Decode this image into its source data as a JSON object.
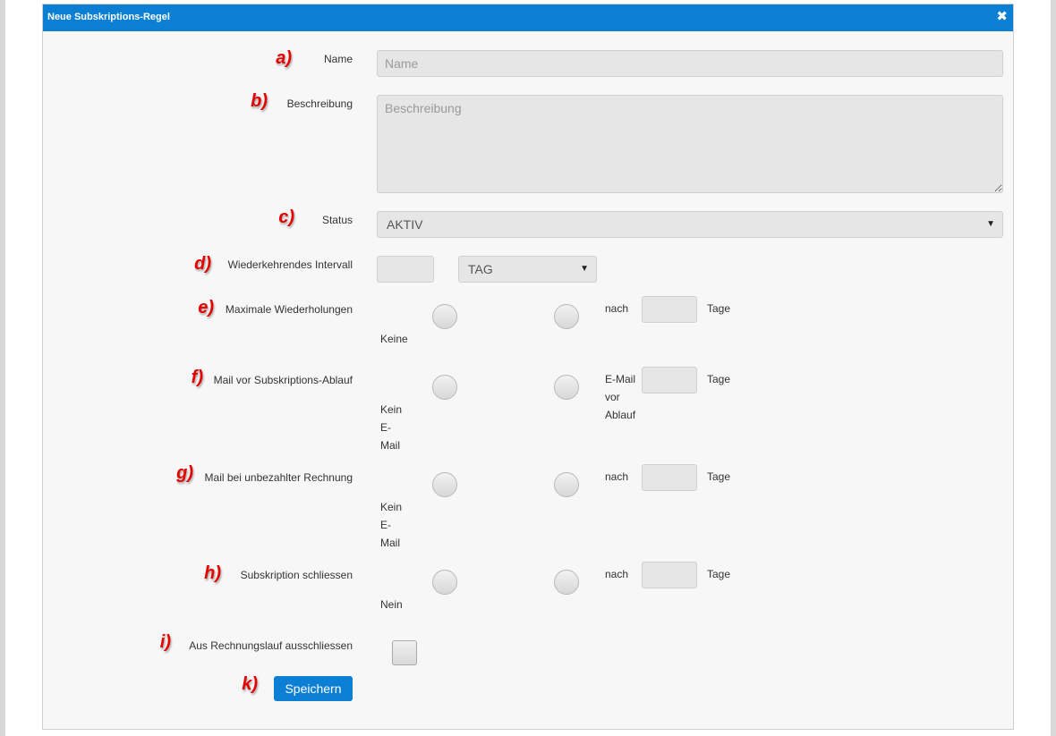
{
  "dialog": {
    "title": "Neue Subskriptions-Regel",
    "close_icon": "✖"
  },
  "markers": {
    "a": "a)",
    "b": "b)",
    "c": "c)",
    "d": "d)",
    "e": "e)",
    "f": "f)",
    "g": "g)",
    "h": "h)",
    "i": "i)",
    "k": "k)"
  },
  "form": {
    "name": {
      "label": "Name",
      "placeholder": "Name"
    },
    "description": {
      "label": "Beschreibung",
      "placeholder": "Beschreibung"
    },
    "status": {
      "label": "Status",
      "value": "AKTIV",
      "arrow": "▼"
    },
    "interval": {
      "label": "Wiederkehrendes Intervall",
      "unit_value": "TAG",
      "arrow": "▼"
    },
    "max_repetitions": {
      "label": "Maximale Wiederholungen",
      "option_none": "Keine",
      "option_after": "nach",
      "unit": "Tage"
    },
    "mail_before_expiry": {
      "label": "Mail vor Subskriptions-Ablauf",
      "option_none": "Kein E-Mail",
      "option_after": "E-Mail vor Ablauf",
      "unit": "Tage"
    },
    "mail_unpaid": {
      "label": "Mail bei unbezahlter Rechnung",
      "option_none": "Kein E-Mail",
      "option_after": "nach",
      "unit": "Tage"
    },
    "close_subscription": {
      "label": "Subskription schliessen",
      "option_none": "Nein",
      "option_after": "nach",
      "unit": "Tage"
    },
    "exclude_billing": {
      "label": "Aus Rechnungslauf ausschliessen"
    },
    "save_label": "Speichern"
  },
  "colors": {
    "titlebar": "#0a7fd4",
    "marker": "#e60000",
    "button": "#0a7fd4"
  }
}
